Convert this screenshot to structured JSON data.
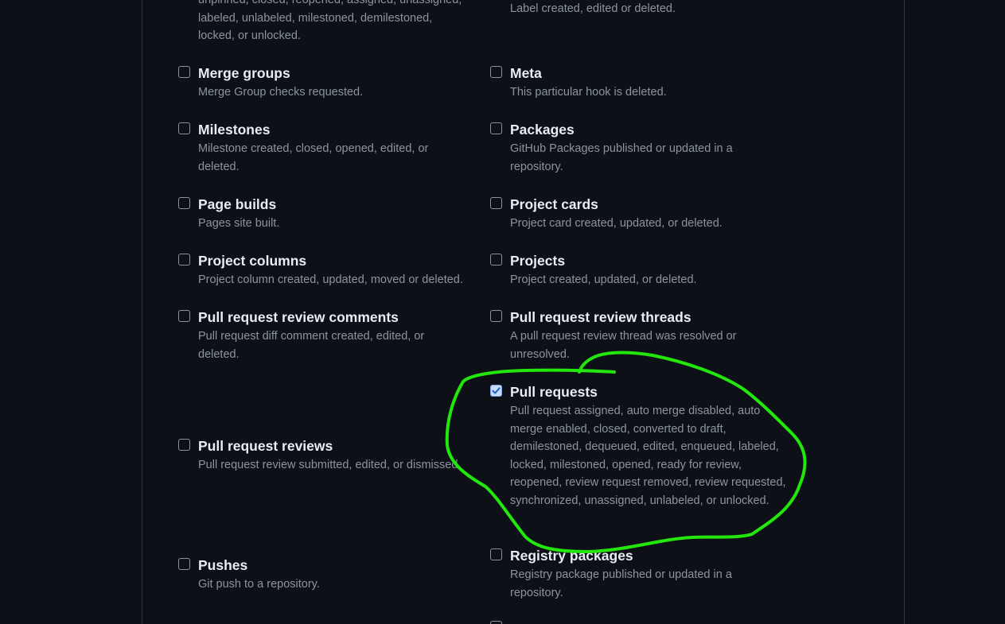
{
  "top_partial": {
    "left_lines": [
      "unpinned, closed, reopened, assigned, unassigned,",
      "labeled, unlabeled, milestoned, demilestoned,",
      "locked, or unlocked."
    ],
    "right_lines": [
      "Label created, edited or deleted."
    ]
  },
  "events": [
    {
      "label": "Merge groups",
      "description": "Merge Group checks requested.",
      "checked": false
    },
    {
      "label": "Meta",
      "description": "This particular hook is deleted.",
      "checked": false
    },
    {
      "label": "Milestones",
      "description": "Milestone created, closed, opened, edited, or deleted.",
      "checked": false
    },
    {
      "label": "Packages",
      "description": "GitHub Packages published or updated in a repository.",
      "checked": false
    },
    {
      "label": "Page builds",
      "description": "Pages site built.",
      "checked": false
    },
    {
      "label": "Project cards",
      "description": "Project card created, updated, or deleted.",
      "checked": false
    },
    {
      "label": "Project columns",
      "description": "Project column created, updated, moved or deleted.",
      "checked": false
    },
    {
      "label": "Projects",
      "description": "Project created, updated, or deleted.",
      "checked": false
    },
    {
      "label": "Pull request review comments",
      "description": "Pull request diff comment created, edited, or deleted.",
      "checked": false
    },
    {
      "label": "Pull request review threads",
      "description": "A pull request review thread was resolved or unresolved.",
      "checked": false
    },
    {
      "label": "Pull request reviews",
      "description": "Pull request review submitted, edited, or dismissed.",
      "checked": false
    },
    {
      "label": "Pull requests",
      "description": "Pull request assigned, auto merge disabled, auto merge enabled, closed, converted to draft, demilestoned, dequeued, edited, enqueued, labeled, locked, milestoned, opened, ready for review, reopened, review request removed, review requested, synchronized, unassigned, unlabeled, or unlocked.",
      "checked": true
    },
    {
      "label": "Pushes",
      "description": "Git push to a repository.",
      "checked": false
    },
    {
      "label": "Registry packages",
      "description": "Registry package published or updated in a repository.",
      "checked": false
    }
  ],
  "colors": {
    "background": "#0d1117",
    "label": "#e6edf3",
    "description": "#8b949e",
    "annotation": "#22e60c"
  }
}
